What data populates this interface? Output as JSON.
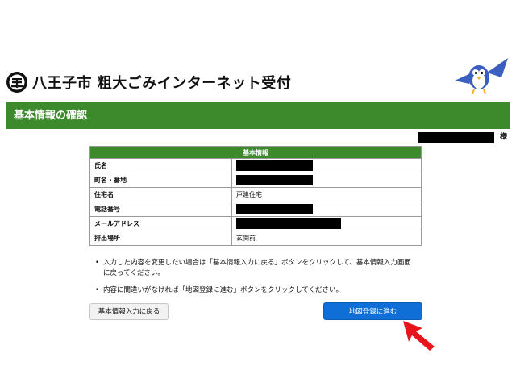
{
  "header": {
    "title": "八王子市 粗大ごみインターネット受付",
    "logo_icon": "hachioji-city-emblem-icon",
    "mascot_icon": "bird-mascot-icon"
  },
  "section": {
    "title": "基本情報の確認"
  },
  "user": {
    "suffix": "様"
  },
  "table": {
    "header": "基本情報",
    "rows": [
      {
        "label": "氏名",
        "value": "",
        "redacted": true
      },
      {
        "label": "町名・番地",
        "value": "",
        "redacted": true
      },
      {
        "label": "住宅名",
        "value": "戸建住宅",
        "redacted": false
      },
      {
        "label": "電話番号",
        "value": "",
        "redacted": true
      },
      {
        "label": "メールアドレス",
        "value": "",
        "redacted": true
      },
      {
        "label": "排出場所",
        "value": "玄関前",
        "redacted": false
      }
    ]
  },
  "notes": [
    "入力した内容を変更したい場合は「基本情報入力に戻る」ボタンをクリックして、基本情報入力画面に戻ってください。",
    "内容に間違いがなければ「地図登録に進む」ボタンをクリックしてください。"
  ],
  "buttons": {
    "back_label": "基本情報入力に戻る",
    "next_label": "地図登録に進む"
  },
  "colors": {
    "green": "#3d8a2c",
    "blue": "#0f6fd6",
    "arrow": "#e8141b"
  },
  "annotation_icon": "red-pointer-arrow-icon"
}
